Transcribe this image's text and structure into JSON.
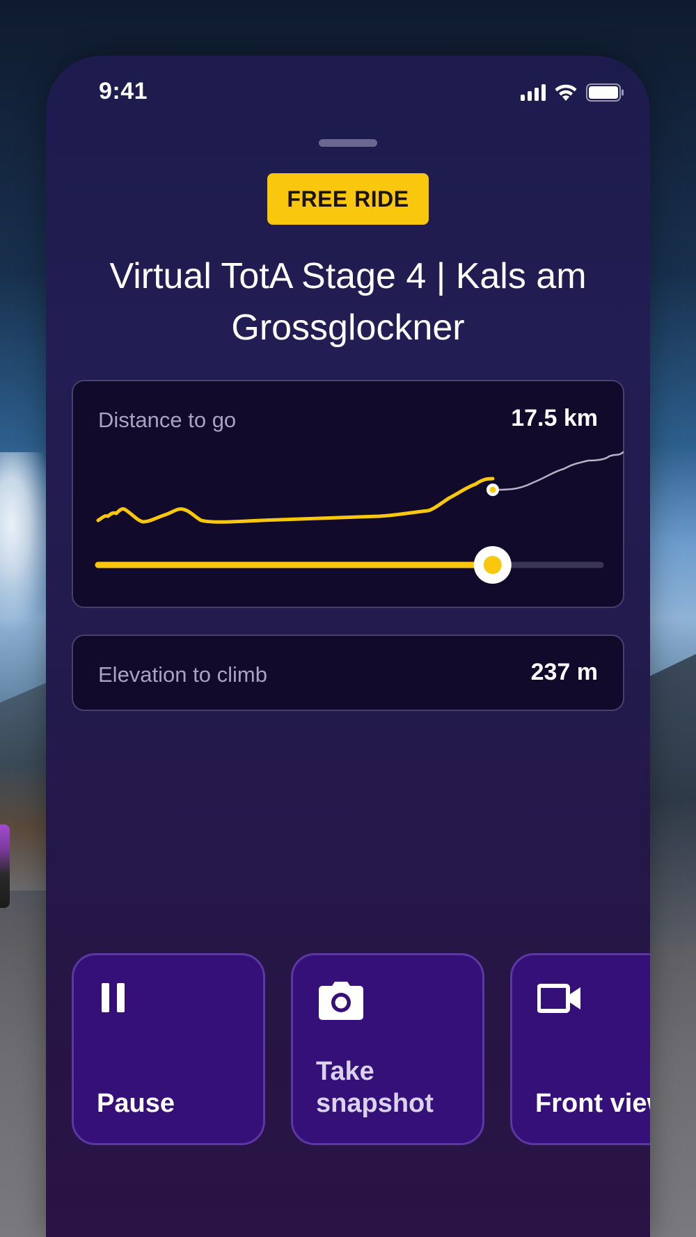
{
  "status_bar": {
    "time": "9:41",
    "icons": [
      "signal-icon",
      "wifi-icon",
      "battery-icon"
    ]
  },
  "badge": {
    "label": "FREE RIDE",
    "color": "#f9c80e"
  },
  "ride": {
    "title": "Virtual TotA Stage 4 | Kals am Grossglockner"
  },
  "distance_card": {
    "label": "Distance to go",
    "value": "17.5 km",
    "progress": 0.785,
    "accent": "#f9c80e"
  },
  "elevation_card": {
    "label": "Elevation to climb",
    "value": "237 m"
  },
  "actions": [
    {
      "icon": "pause-icon",
      "label": "Pause"
    },
    {
      "icon": "camera-icon",
      "label": "Take\nsnapshot"
    },
    {
      "icon": "video-camera-icon",
      "label": "Front view"
    }
  ]
}
